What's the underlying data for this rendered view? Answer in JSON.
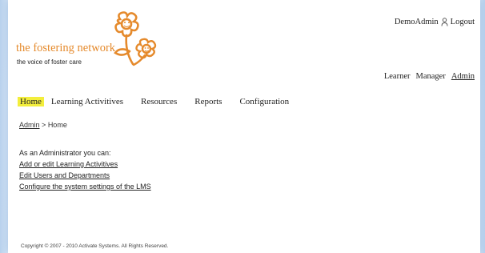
{
  "logo": {
    "title": "the fostering network",
    "tagline": "the voice of foster care"
  },
  "user": {
    "name": "DemoAdmin",
    "logout_label": "Logout"
  },
  "roles": {
    "items": [
      "Learner",
      "Manager",
      "Admin"
    ],
    "active": "Admin"
  },
  "nav": {
    "items": [
      "Home",
      "Learning Activitives",
      "Resources",
      "Reports",
      "Configuration"
    ],
    "active": "Home"
  },
  "breadcrumb": {
    "root": "Admin",
    "separator": ">",
    "current": "Home"
  },
  "content": {
    "intro": "As an Administrator you can:",
    "links": [
      "Add or edit Learning Activitives",
      "Edit Users and Departments",
      "Configure the system settings of the LMS"
    ]
  },
  "footer": {
    "copyright": "Copyright © 2007 - 2010 Activate Systems. All Rights Reserved."
  },
  "colors": {
    "brand_orange": "#e58a2c",
    "nav_highlight": "#f3ee3c",
    "background_glow": "#dfeaf6"
  }
}
